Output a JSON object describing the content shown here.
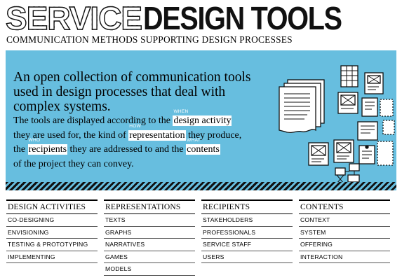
{
  "header": {
    "logo_service": "SERVICE",
    "logo_tools": "DESIGN TOOLS",
    "subtitle": "COMMUNICATION METHODS SUPPORTING DESIGN PROCESSES"
  },
  "hero": {
    "lead": "An open collection of communication tools used in design processes that deal with complex systems.",
    "p1_a": "The tools are displayed according to the ",
    "p1_link": "design activity",
    "p1_tag": "WHEN",
    "p2_a": "they are used for, the kind of ",
    "p2_link": "representation",
    "p2_tag": "HOW",
    "p2_b": " they produce,",
    "p3_a": "the ",
    "p3_link": "recipients",
    "p3_tag": "WHO",
    "p3_b": " they are addressed to and the ",
    "p3_link2": "contents",
    "p3_tag2": "WHAT",
    "p4": "of the project they can convey."
  },
  "columns": [
    {
      "title": "DESIGN ACTIVITIES",
      "items": [
        "CO-DESIGNING",
        "ENVISIONING",
        "TESTING & PROTOTYPING",
        "IMPLEMENTING"
      ]
    },
    {
      "title": "REPRESENTATIONS",
      "items": [
        "TEXTS",
        "GRAPHS",
        "NARRATIVES",
        "GAMES",
        "MODELS"
      ]
    },
    {
      "title": "RECIPIENTS",
      "items": [
        "STAKEHOLDERS",
        "PROFESSIONALS",
        "SERVICE STAFF",
        "USERS"
      ]
    },
    {
      "title": "CONTENTS",
      "items": [
        "CONTEXT",
        "SYSTEM",
        "OFFERING",
        "INTERACTION"
      ]
    }
  ],
  "colors": {
    "hero_blue": "#67bedf",
    "ink": "#111111"
  }
}
